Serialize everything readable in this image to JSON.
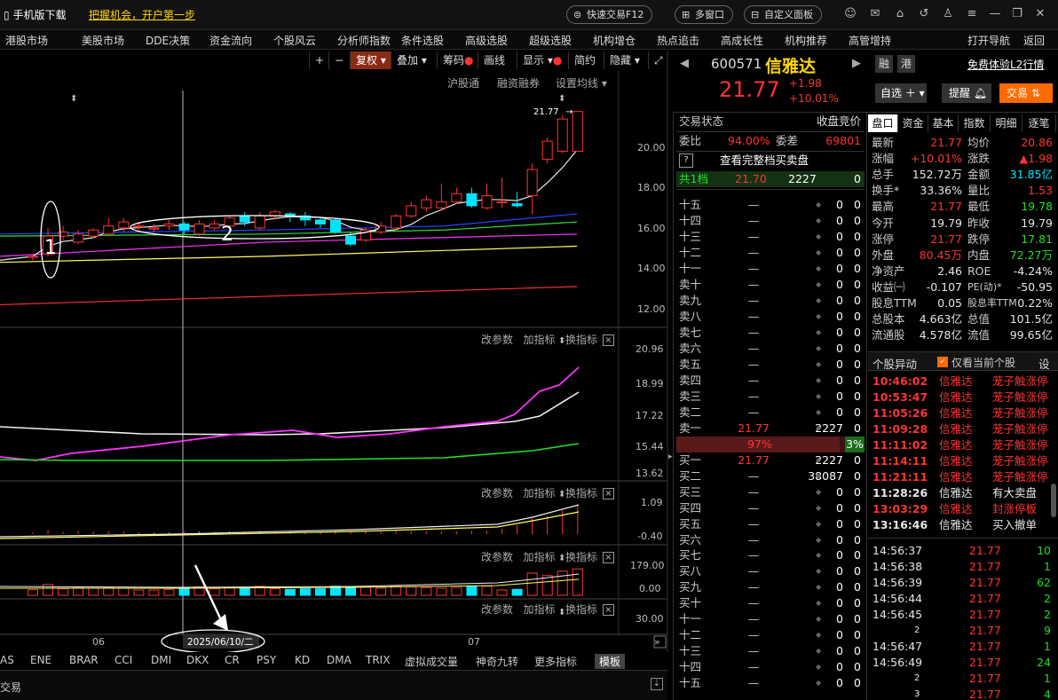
{
  "topbar": {
    "mobile_download": "手机版下载",
    "promo": "把握机会，开户第一步",
    "quick_trade": "快速交易F12",
    "multi_window": "多窗口",
    "custom_panel": "自定义面板"
  },
  "menu": [
    "港股市场",
    "美股市场",
    "DDE决策",
    "资金流向",
    "个股风云",
    "分析师指数",
    "条件选股",
    "高级选股",
    "超级选股",
    "机构增仓",
    "热点追击",
    "高成长性",
    "机构推荐",
    "高管增持"
  ],
  "menu_right": [
    "打开导航",
    "返回"
  ],
  "chart_toolbar": {
    "plus": "+",
    "minus": "−",
    "fuquan": "复权",
    "overlay": "叠加",
    "chips": "筹码",
    "draw": "画线",
    "display": "显示",
    "simple": "简约",
    "hide": "隐藏"
  },
  "chart_subtools": {
    "hgt": "沪股通",
    "rzrq": "融资融券",
    "ma_setting": "设置均线"
  },
  "ind_header": {
    "params": "改参数",
    "add": "加指标",
    "switch": "换指标",
    "close": "×"
  },
  "price_axis": [
    "20.00",
    "18.00",
    "16.00",
    "14.00",
    "12.00"
  ],
  "high_marker": "21.77",
  "annotations": {
    "n1": "1",
    "n2": "2"
  },
  "sub1_axis": [
    "20.96",
    "18.99",
    "17.22",
    "15.44",
    "13.62"
  ],
  "sub2_axis": [
    "1.09",
    "-0.40"
  ],
  "sub3_axis": [
    "179.00",
    "0.00"
  ],
  "sub4_axis": [
    "30.00"
  ],
  "date_axis": {
    "m06": "06",
    "m07": "07",
    "cursor_date": "2025/06/10/二"
  },
  "bottom_tabs": [
    "AS",
    "ENE",
    "BRAR",
    "CCI",
    "DMI",
    "DKX",
    "CR",
    "PSY",
    "KD",
    "DMA",
    "TRIX",
    "虚拟成交量",
    "神奇九转",
    "更多指标",
    "模板"
  ],
  "bottom_left": "交易",
  "stock": {
    "code": "600571",
    "name": "信雅达",
    "rong": "融",
    "gang": "港",
    "l2": "免费体验L2行情",
    "price": "21.77",
    "change": "+1.98",
    "pct": "+10.01%",
    "zixuan": "自选",
    "tixing": "提醒",
    "jiaoyi": "交易"
  },
  "orderbook": {
    "status_label": "交易状态",
    "status_value": "收盘竞价",
    "weibi_label": "委比",
    "weibi_value": "94.00%",
    "weicha_label": "委差",
    "weicha_value": "69801",
    "full_depth": "查看完整档买卖盘",
    "help": "?",
    "gong": {
      "label": "共1档",
      "price": "21.70",
      "vol": "2227",
      "n": "0"
    },
    "sells": [
      {
        "label": "十五",
        "price": "—",
        "vol": "0",
        "n": "0"
      },
      {
        "label": "十四",
        "price": "—",
        "vol": "0",
        "n": "0"
      },
      {
        "label": "十三",
        "price": "—",
        "vol": "0",
        "n": "0"
      },
      {
        "label": "十二",
        "price": "—",
        "vol": "0",
        "n": "0"
      },
      {
        "label": "十一",
        "price": "—",
        "vol": "0",
        "n": "0"
      },
      {
        "label": "卖十",
        "price": "—",
        "vol": "0",
        "n": "0"
      },
      {
        "label": "卖九",
        "price": "—",
        "vol": "0",
        "n": "0"
      },
      {
        "label": "卖八",
        "price": "—",
        "vol": "0",
        "n": "0"
      },
      {
        "label": "卖七",
        "price": "—",
        "vol": "0",
        "n": "0"
      },
      {
        "label": "卖六",
        "price": "—",
        "vol": "0",
        "n": "0"
      },
      {
        "label": "卖五",
        "price": "—",
        "vol": "0",
        "n": "0"
      },
      {
        "label": "卖四",
        "price": "—",
        "vol": "0",
        "n": "0"
      },
      {
        "label": "卖三",
        "price": "—",
        "vol": "0",
        "n": "0"
      },
      {
        "label": "卖二",
        "price": "—",
        "vol": "0",
        "n": "0"
      },
      {
        "label": "卖一",
        "price": "21.77",
        "vol": "2227",
        "n": "0"
      }
    ],
    "ratio_buy": "97%",
    "ratio_sell": "3%",
    "ratio_buy_fraction": 0.97,
    "buys": [
      {
        "label": "买一",
        "price": "21.77",
        "vol": "2227",
        "n": "0"
      },
      {
        "label": "买二",
        "price": "—",
        "vol": "38087",
        "n": "0"
      },
      {
        "label": "买三",
        "price": "—",
        "vol": "0",
        "n": "0"
      },
      {
        "label": "买四",
        "price": "—",
        "vol": "0",
        "n": "0"
      },
      {
        "label": "买五",
        "price": "—",
        "vol": "0",
        "n": "0"
      },
      {
        "label": "买六",
        "price": "—",
        "vol": "0",
        "n": "0"
      },
      {
        "label": "买七",
        "price": "—",
        "vol": "0",
        "n": "0"
      },
      {
        "label": "买八",
        "price": "—",
        "vol": "0",
        "n": "0"
      },
      {
        "label": "买九",
        "price": "—",
        "vol": "0",
        "n": "0"
      },
      {
        "label": "买十",
        "price": "—",
        "vol": "0",
        "n": "0"
      },
      {
        "label": "十一",
        "price": "—",
        "vol": "0",
        "n": "0"
      },
      {
        "label": "十二",
        "price": "—",
        "vol": "0",
        "n": "0"
      },
      {
        "label": "十三",
        "price": "—",
        "vol": "0",
        "n": "0"
      },
      {
        "label": "十四",
        "price": "—",
        "vol": "0",
        "n": "0"
      },
      {
        "label": "十五",
        "price": "—",
        "vol": "0",
        "n": "0"
      }
    ]
  },
  "tabs": [
    "盘口",
    "资金",
    "基本",
    "指数",
    "明细",
    "逐笔"
  ],
  "stats": [
    {
      "l1": "最新",
      "v1": "21.77",
      "c1": "red",
      "l2": "均价",
      "v2": "20.86",
      "c2": "red"
    },
    {
      "l1": "涨幅",
      "v1": "+10.01%",
      "c1": "red",
      "l2": "涨跌",
      "v2": "▲1.98",
      "c2": "red"
    },
    {
      "l1": "总手",
      "v1": "152.72万",
      "c1": "wht",
      "l2": "金额",
      "v2": "31.85亿",
      "c2": "cyan"
    },
    {
      "l1": "换手*",
      "v1": "33.36%",
      "c1": "wht",
      "l2": "量比",
      "v2": "1.53",
      "c2": "red"
    },
    {
      "l1": "最高",
      "v1": "21.77",
      "c1": "red",
      "l2": "最低",
      "v2": "19.78",
      "c2": "grn"
    },
    {
      "l1": "今开",
      "v1": "19.79",
      "c1": "wht",
      "l2": "昨收",
      "v2": "19.79",
      "c2": "wht"
    },
    {
      "l1": "涨停",
      "v1": "21.77",
      "c1": "red",
      "l2": "跌停",
      "v2": "17.81",
      "c2": "grn"
    },
    {
      "l1": "外盘",
      "v1": "80.45万",
      "c1": "red",
      "l2": "内盘",
      "v2": "72.27万",
      "c2": "grn"
    },
    {
      "l1": "净资产",
      "v1": "2.46",
      "c1": "wht",
      "l2": "ROE",
      "v2": "-4.24%",
      "c2": "wht"
    },
    {
      "l1": "收益㈠",
      "v1": "-0.107",
      "c1": "wht",
      "l2": "PE(动)*",
      "v2": "-50.95",
      "c2": "wht"
    },
    {
      "l1": "股息TTM",
      "v1": "0.05",
      "c1": "wht",
      "l2": "股息率TTM",
      "v2": "0.22%",
      "c2": "wht"
    },
    {
      "l1": "总股本",
      "v1": "4.663亿",
      "c1": "wht",
      "l2": "总值",
      "v2": "101.5亿",
      "c2": "wht"
    },
    {
      "l1": "流通股",
      "v1": "4.578亿",
      "c1": "wht",
      "l2": "流值",
      "v2": "99.65亿",
      "c2": "wht"
    }
  ],
  "events": {
    "title": "个股异动",
    "only_current": "仅看当前个股",
    "setting": "设",
    "rows": [
      {
        "t": "10:46:02",
        "n": "信雅达",
        "e": "茏子触涨停",
        "c": "red"
      },
      {
        "t": "10:53:47",
        "n": "信雅达",
        "e": "茏子触涨停",
        "c": "red"
      },
      {
        "t": "11:05:26",
        "n": "信雅达",
        "e": "茏子触涨停",
        "c": "red"
      },
      {
        "t": "11:09:28",
        "n": "信雅达",
        "e": "茏子触涨停",
        "c": "red"
      },
      {
        "t": "11:11:02",
        "n": "信雅达",
        "e": "茏子触涨停",
        "c": "red"
      },
      {
        "t": "11:14:11",
        "n": "信雅达",
        "e": "茏子触涨停",
        "c": "red"
      },
      {
        "t": "11:21:11",
        "n": "信雅达",
        "e": "茏子触涨停",
        "c": "red"
      },
      {
        "t": "11:28:26",
        "n": "信雅达",
        "e": "有大卖盘",
        "c": "wht"
      },
      {
        "t": "13:03:29",
        "n": "信雅达",
        "e": "封涨停板",
        "c": "red"
      },
      {
        "t": "13:16:46",
        "n": "信雅达",
        "e": "买入撤单",
        "c": "wht"
      }
    ]
  },
  "ticks": [
    {
      "t": "14:56:37",
      "p": "21.77",
      "v": "10"
    },
    {
      "t": "14:56:38",
      "p": "21.77",
      "v": "1"
    },
    {
      "t": "14:56:39",
      "p": "21.77",
      "v": "62"
    },
    {
      "t": "14:56:44",
      "p": "21.77",
      "v": "2"
    },
    {
      "t": "14:56:45",
      "p": "21.77",
      "v": "2"
    },
    {
      "t": "2",
      "p": "21.77",
      "v": "9"
    },
    {
      "t": "14:56:47",
      "p": "21.77",
      "v": "1"
    },
    {
      "t": "14:56:49",
      "p": "21.77",
      "v": "24"
    },
    {
      "t": "2",
      "p": "21.77",
      "v": "1"
    },
    {
      "t": "3",
      "p": "21.77",
      "v": "4"
    }
  ],
  "candles": [
    {
      "o": 14.55,
      "c": 14.6,
      "h": 14.7,
      "l": 14.4
    },
    {
      "o": 14.7,
      "c": 15.6,
      "h": 16.0,
      "l": 14.6
    },
    {
      "o": 15.6,
      "c": 15.8,
      "h": 16.1,
      "l": 15.4
    },
    {
      "o": 15.3,
      "c": 15.7,
      "h": 15.9,
      "l": 15.2
    },
    {
      "o": 15.6,
      "c": 15.9,
      "h": 16.0,
      "l": 15.5
    },
    {
      "o": 15.7,
      "c": 16.1,
      "h": 16.5,
      "l": 15.6
    },
    {
      "o": 16.0,
      "c": 16.3,
      "h": 16.5,
      "l": 15.8
    },
    {
      "o": 16.1,
      "c": 16.1,
      "h": 16.3,
      "l": 15.9
    },
    {
      "o": 16.0,
      "c": 16.0,
      "h": 16.2,
      "l": 15.8
    },
    {
      "o": 16.1,
      "c": 16.2,
      "h": 16.4,
      "l": 15.9
    },
    {
      "o": 16.2,
      "c": 15.9,
      "h": 16.3,
      "l": 15.7
    },
    {
      "o": 15.7,
      "c": 16.2,
      "h": 16.4,
      "l": 15.6
    },
    {
      "o": 16.0,
      "c": 16.2,
      "h": 16.4,
      "l": 15.9
    },
    {
      "o": 16.1,
      "c": 16.5,
      "h": 16.6,
      "l": 16.0
    },
    {
      "o": 16.6,
      "c": 16.3,
      "h": 16.8,
      "l": 16.1
    },
    {
      "o": 16.0,
      "c": 16.6,
      "h": 16.8,
      "l": 15.9
    },
    {
      "o": 16.6,
      "c": 16.8,
      "h": 16.9,
      "l": 16.4
    },
    {
      "o": 16.7,
      "c": 16.6,
      "h": 16.8,
      "l": 16.3
    },
    {
      "o": 16.6,
      "c": 16.4,
      "h": 16.8,
      "l": 16.1
    },
    {
      "o": 16.4,
      "c": 16.2,
      "h": 16.5,
      "l": 16.0
    },
    {
      "o": 16.4,
      "c": 15.8,
      "h": 16.5,
      "l": 15.7
    },
    {
      "o": 15.6,
      "c": 15.2,
      "h": 15.8,
      "l": 15.1
    },
    {
      "o": 15.4,
      "c": 15.9,
      "h": 16.0,
      "l": 15.3
    },
    {
      "o": 15.8,
      "c": 16.1,
      "h": 16.3,
      "l": 15.7
    },
    {
      "o": 16.0,
      "c": 16.6,
      "h": 16.7,
      "l": 15.9
    },
    {
      "o": 16.6,
      "c": 17.1,
      "h": 17.3,
      "l": 16.5
    },
    {
      "o": 17.0,
      "c": 17.4,
      "h": 17.6,
      "l": 16.8
    },
    {
      "o": 17.0,
      "c": 17.3,
      "h": 18.2,
      "l": 16.9
    },
    {
      "o": 17.3,
      "c": 17.7,
      "h": 18.0,
      "l": 17.2
    },
    {
      "o": 17.7,
      "c": 17.1,
      "h": 18.0,
      "l": 17.0
    },
    {
      "o": 17.0,
      "c": 17.6,
      "h": 18.2,
      "l": 16.9
    },
    {
      "o": 17.3,
      "c": 17.3,
      "h": 18.5,
      "l": 17.0
    },
    {
      "o": 17.2,
      "c": 17.1,
      "h": 17.8,
      "l": 17.0
    },
    {
      "o": 17.6,
      "c": 18.9,
      "h": 19.2,
      "l": 16.7
    },
    {
      "o": 19.4,
      "c": 20.3,
      "h": 20.5,
      "l": 19.2
    },
    {
      "o": 19.8,
      "c": 21.4,
      "h": 21.6,
      "l": 19.7
    },
    {
      "o": 19.8,
      "c": 21.77,
      "h": 21.77,
      "l": 19.78
    }
  ],
  "colors": {
    "up": "#ff3333",
    "down": "#00e5ff",
    "bg": "#000000",
    "accent_orange": "#ff6a00"
  }
}
